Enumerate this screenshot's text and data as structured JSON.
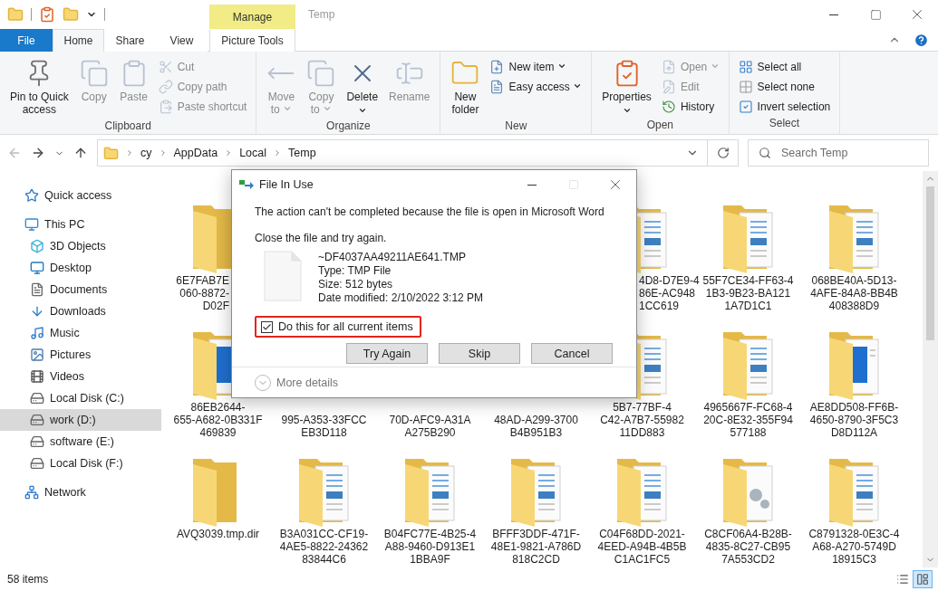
{
  "title_bar": {
    "context_tab": "Manage",
    "title": "Temp"
  },
  "ribbon_tabs": [
    {
      "label": "File",
      "kind": "file",
      "selected": false
    },
    {
      "label": "Home",
      "kind": "tab",
      "selected": true
    },
    {
      "label": "Share",
      "kind": "tab",
      "selected": false
    },
    {
      "label": "View",
      "kind": "tab",
      "selected": false
    },
    {
      "label": "Picture Tools",
      "kind": "context",
      "selected": false
    }
  ],
  "ribbon_groups": [
    {
      "name": "Clipboard",
      "items": [
        {
          "lines": [
            "Pin to Quick",
            "access"
          ],
          "kind": "large",
          "disabled": false
        },
        {
          "lines": [
            "Copy"
          ],
          "kind": "large",
          "disabled": true
        },
        {
          "lines": [
            "Paste"
          ],
          "kind": "large",
          "disabled": true
        },
        {
          "lines": [
            "Cut"
          ],
          "kind": "small",
          "disabled": true
        },
        {
          "lines": [
            "Copy path"
          ],
          "kind": "small",
          "disabled": true
        },
        {
          "lines": [
            "Paste shortcut"
          ],
          "kind": "small",
          "disabled": true
        }
      ]
    },
    {
      "name": "Organize",
      "items": [
        {
          "lines": [
            "Move",
            "to"
          ],
          "kind": "large-menu",
          "disabled": true
        },
        {
          "lines": [
            "Copy",
            "to"
          ],
          "kind": "large-menu",
          "disabled": true
        },
        {
          "lines": [
            "Delete"
          ],
          "kind": "large-split",
          "disabled": false
        },
        {
          "lines": [
            "Rename"
          ],
          "kind": "large",
          "disabled": true
        }
      ]
    },
    {
      "name": "New",
      "items": [
        {
          "lines": [
            "New",
            "folder"
          ],
          "kind": "large",
          "disabled": false
        },
        {
          "lines": [
            "New item"
          ],
          "kind": "small-menu",
          "disabled": false
        },
        {
          "lines": [
            "Easy access"
          ],
          "kind": "small-menu",
          "disabled": false
        }
      ]
    },
    {
      "name": "Open",
      "items": [
        {
          "lines": [
            "Properties"
          ],
          "kind": "large-split",
          "disabled": false
        },
        {
          "lines": [
            "Open"
          ],
          "kind": "small-menu",
          "disabled": true
        },
        {
          "lines": [
            "Edit"
          ],
          "kind": "small",
          "disabled": true
        },
        {
          "lines": [
            "History"
          ],
          "kind": "small",
          "disabled": false
        }
      ]
    },
    {
      "name": "Select",
      "items": [
        {
          "lines": [
            "Select all"
          ],
          "kind": "small",
          "disabled": false
        },
        {
          "lines": [
            "Select none"
          ],
          "kind": "small",
          "disabled": false
        },
        {
          "lines": [
            "Invert selection"
          ],
          "kind": "small",
          "disabled": false
        }
      ]
    }
  ],
  "address": {
    "crumbs": [
      "cy",
      "AppData",
      "Local",
      "Temp"
    ],
    "search_placeholder": "Search Temp"
  },
  "sidebar": {
    "items": [
      {
        "label": "Quick access",
        "selected": false
      },
      {
        "label": "This PC",
        "selected": false,
        "children": [
          {
            "label": "3D Objects",
            "selected": false
          },
          {
            "label": "Desktop",
            "selected": false
          },
          {
            "label": "Documents",
            "selected": false
          },
          {
            "label": "Downloads",
            "selected": false
          },
          {
            "label": "Music",
            "selected": false
          },
          {
            "label": "Pictures",
            "selected": false
          },
          {
            "label": "Videos",
            "selected": false
          },
          {
            "label": "Local Disk (C:)",
            "selected": false
          },
          {
            "label": "work (D:)",
            "selected": true
          },
          {
            "label": "software (E:)",
            "selected": false
          },
          {
            "label": "Local Disk (F:)",
            "selected": false
          }
        ]
      },
      {
        "label": "Network",
        "selected": false
      }
    ]
  },
  "files": [
    {
      "kind": "folder",
      "lines": [
        "6E7FAB7E",
        "060-8872-",
        "D02F"
      ]
    },
    {
      "kind": "covered"
    },
    {
      "kind": "covered"
    },
    {
      "kind": "covered"
    },
    {
      "kind": "folder-doc",
      "lines": [
        "4D8-D7E9-4",
        "86E-AC948",
        "1CC619"
      ]
    },
    {
      "kind": "folder-doc",
      "lines": [
        "55F7CE34-FF63-4",
        "1B3-9B23-BA121",
        "1A7D1C1"
      ]
    },
    {
      "kind": "folder-doc",
      "lines": [
        "068BE40A-5D13-",
        "4AFE-84A8-BB4B",
        "408388D9"
      ]
    },
    {
      "kind": "folder-window",
      "lines": [
        "86EB2644-",
        "655-A682-0B331F",
        "469839"
      ]
    },
    {
      "kind": "covered",
      "lines": [
        "995-A353-33FCC",
        "EB3D118"
      ]
    },
    {
      "kind": "covered",
      "lines": [
        "70D-AFC9-A31A",
        "A275B290"
      ]
    },
    {
      "kind": "covered",
      "lines": [
        "48AD-A299-3700",
        "B4B951B3"
      ]
    },
    {
      "kind": "folder-doc",
      "lines": [
        "5B7-77BF-4",
        "C42-A7B7-55982",
        "11DD883"
      ]
    },
    {
      "kind": "folder-doc",
      "lines": [
        "4965667F-FC68-4",
        "20C-8E32-355F94",
        "577188"
      ]
    },
    {
      "kind": "folder-window",
      "lines": [
        "AE8DD508-FF6B-",
        "4650-8790-3F5C3",
        "D8D112A"
      ]
    },
    {
      "kind": "folder",
      "lines": [
        "AVQ3039.tmp.dir"
      ]
    },
    {
      "kind": "folder-doc",
      "lines": [
        "B3A031CC-CF19-",
        "4AE5-8822-24362",
        "83844C6"
      ]
    },
    {
      "kind": "folder-doc",
      "lines": [
        "B04FC77E-4B25-4",
        "A88-9460-D913E1",
        "1BBA9F"
      ]
    },
    {
      "kind": "folder-doc",
      "lines": [
        "BFFF3DDF-471F-",
        "48E1-9821-A786D",
        "818C2CD"
      ]
    },
    {
      "kind": "folder-doc",
      "lines": [
        "C04F68DD-2021-",
        "4EED-A94B-4B5B",
        "C1AC1FC5"
      ]
    },
    {
      "kind": "folder-gear",
      "lines": [
        "C8CF06A4-B28B-",
        "4835-8C27-CB95",
        "7A553CD2"
      ]
    },
    {
      "kind": "folder-doc",
      "lines": [
        "C8791328-0E3C-4",
        "A68-A270-5749D",
        "18915C3"
      ]
    }
  ],
  "dialog": {
    "title": "File In Use",
    "message": "The action can't be completed because the file is open in Microsoft Word",
    "instruction": "Close the file and try again.",
    "file": {
      "name": "~DF4037AA49211AE641.TMP",
      "type": "Type: TMP File",
      "size": "Size: 512 bytes",
      "modified": "Date modified: 2/10/2022 3:12 PM"
    },
    "checkbox": {
      "label": "Do this for all current items",
      "checked": true,
      "highlighted": true
    },
    "buttons": [
      "Try Again",
      "Skip",
      "Cancel"
    ],
    "details": {
      "label": "More details",
      "expanded": false
    }
  },
  "status_bar": {
    "count": "58 items",
    "views": [
      {
        "selected": false
      },
      {
        "selected": true
      }
    ]
  }
}
